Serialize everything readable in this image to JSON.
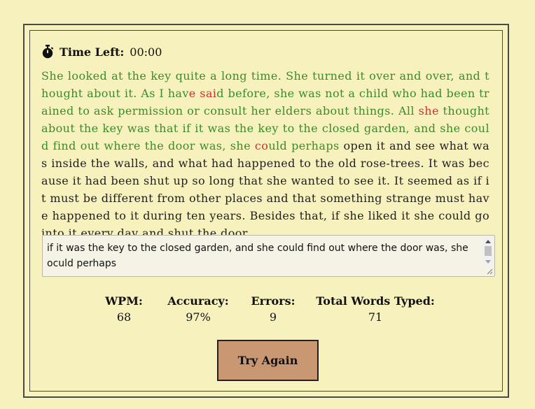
{
  "timer": {
    "label": "Time Left:",
    "value": "00:00",
    "icon": "stopwatch-icon"
  },
  "passage": {
    "segments": [
      {
        "text": "She looked at the key quite a long time. She turned it over and over, and thought about it. As I hav",
        "state": "correct"
      },
      {
        "text": "e",
        "state": "error"
      },
      {
        "text": " ",
        "state": "correct"
      },
      {
        "text": "sai",
        "state": "error"
      },
      {
        "text": "d before, she was not a child who had been trained to ask permission or consult her elders about things. All ",
        "state": "correct"
      },
      {
        "text": "she",
        "state": "error"
      },
      {
        "text": " thought about the key was that if it was the key to the closed garden, and she could find out where the door was, she ",
        "state": "correct"
      },
      {
        "text": "co",
        "state": "error"
      },
      {
        "text": "uld perhaps",
        "state": "correct"
      },
      {
        "text": " open it and see what was inside the walls, and what had happened to the old rose-trees. It was because it had been shut up so long that she wanted to see it. It seemed as if it must be different from other places and that something strange must have happened to it during ten years. Besides that, if she liked it she could go into it every day and shut the door",
        "state": "pending"
      }
    ]
  },
  "input": {
    "value": "if it was the key to the closed garden, and she could find out where the door was, she oculd perhaps"
  },
  "stats": [
    {
      "label": "WPM:",
      "value": "68"
    },
    {
      "label": "Accuracy:",
      "value": "97%"
    },
    {
      "label": "Errors:",
      "value": "9"
    },
    {
      "label": "Total Words Typed:",
      "value": "71"
    }
  ],
  "button": {
    "label": "Try Again"
  },
  "colors": {
    "background": "#f7f2bd",
    "correct": "#3b8b2b",
    "error": "#d0302a",
    "pending": "#1f1f1f",
    "button": "#c99873"
  }
}
